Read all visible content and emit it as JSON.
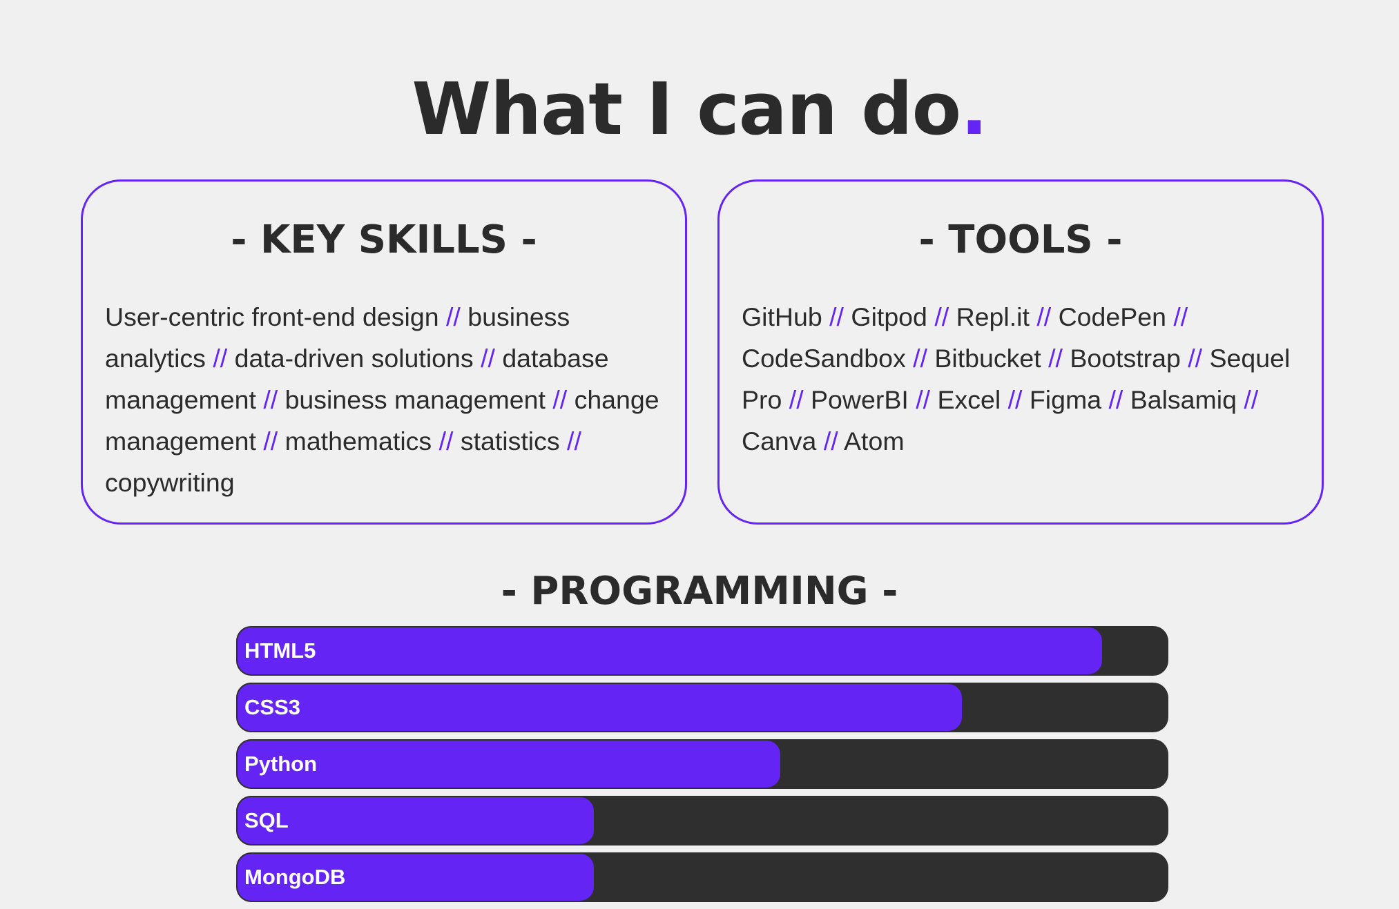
{
  "page": {
    "title": "What I can do",
    "title_dot": "."
  },
  "key_skills": {
    "title": "- KEY SKILLS -",
    "separator": "//",
    "items": [
      "User-centric front-end design",
      "business analytics",
      "data-driven solutions",
      "database management",
      "business management",
      "change management",
      "mathematics",
      "statistics",
      "copywriting"
    ]
  },
  "tools": {
    "title": "- TOOLS -",
    "separator": "//",
    "items": [
      "GitHub",
      "Gitpod",
      "Repl.it",
      "CodePen",
      "CodeSandbox",
      "Bitbucket",
      "Bootstrap",
      "Sequel Pro",
      "PowerBI",
      "Excel",
      "Figma",
      "Balsamiq",
      "Canva",
      "Atom"
    ]
  },
  "programming": {
    "title": "- PROGRAMMING -",
    "skills": [
      {
        "label": "HTML5",
        "level": 0.93
      },
      {
        "label": "CSS3",
        "level": 0.78
      },
      {
        "label": "Python",
        "level": 0.585
      },
      {
        "label": "SQL",
        "level": 0.385
      },
      {
        "label": "MongoDB",
        "level": 0.385
      }
    ]
  },
  "colors": {
    "accent": "#6424f4",
    "text": "#2b2b2b",
    "background": "#f0f0f0",
    "bar_track": "#2f2f2f"
  }
}
